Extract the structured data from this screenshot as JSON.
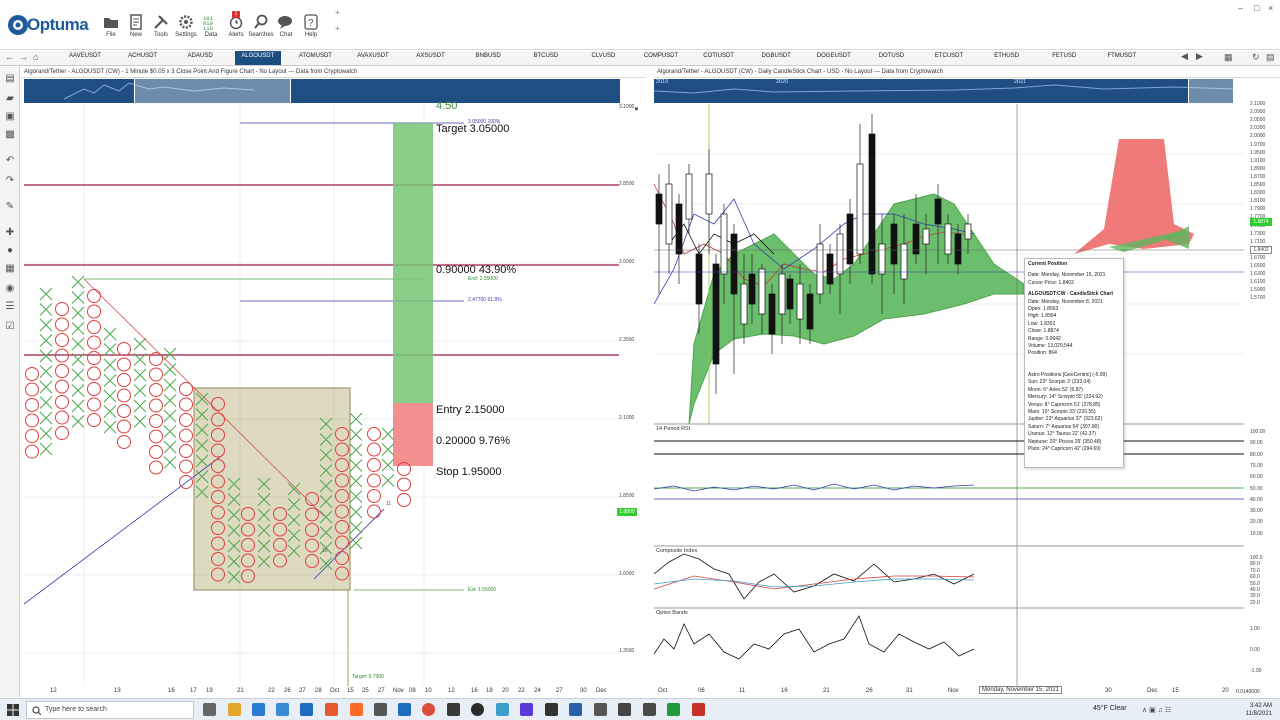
{
  "app": {
    "brand": "Optuma"
  },
  "toolbar": [
    {
      "label": "File",
      "icon": "folder-icon"
    },
    {
      "label": "New",
      "icon": "new-page-icon"
    },
    {
      "label": "Tools",
      "icon": "tools-icon"
    },
    {
      "label": "Settings",
      "icon": "gear-icon"
    },
    {
      "label": "Data",
      "icon": "data-icon"
    },
    {
      "label": "Alerts",
      "icon": "alarm-clock-icon",
      "badge": "1"
    },
    {
      "label": "Searches",
      "icon": "search-icon"
    },
    {
      "label": "Chat",
      "icon": "chat-icon"
    },
    {
      "label": "Help",
      "icon": "help-icon"
    }
  ],
  "symbols": [
    "AAVEUSDT",
    "ACHUSDT",
    "ADAUSD",
    "ALGOUSDT",
    "ATOMUSDT",
    "AVAXUSDT",
    "AXSUSDT",
    "BNBUSD",
    "BTCUSD",
    "CLVUSD",
    "COMPUSDT",
    "COTIUSDT",
    "DGBUSDT",
    "DOGEUSDT",
    "DOTUSD",
    "ETCUSDT",
    "ETHUSD",
    "FETUSD",
    "FTMUSDT"
  ],
  "active_symbol": "ALGOUSDT",
  "left_chart": {
    "title": "Algorand/Tether - ALGOUSDT (CW) - 1 Minute $0.05 x 3 Close Point And Figure Chart - No Layout --- Data from Cryptowatch",
    "y_ticks": [
      "3.1000",
      "2.8500",
      "2.6000",
      "2.3500",
      "2.1000",
      "1.8500",
      "1.6000",
      "1.3500"
    ],
    "price_badge": "1.8800",
    "x_ticks": [
      "12",
      "13",
      "16",
      "17",
      "19",
      "21",
      "22",
      "26",
      "27",
      "28",
      "Oct",
      "15",
      "25",
      "27",
      "Nov",
      "08",
      "10",
      "12",
      "16",
      "18",
      "20",
      "22",
      "24",
      "27",
      "30",
      "Dec"
    ],
    "top_value": "4.50",
    "target": "Target  3.05000",
    "ratio_up": "0.90000  43.90%",
    "entry": "Entry  2.15000",
    "ratio_down": "0.20000  9.76%",
    "stop": "Stop  1.95000",
    "small_target": "3.05000   100%",
    "small_end": "End: 2.55000",
    "small_fib": "2.47700   61.8%",
    "small_ext": "Ext: 1.55000",
    "small_target2": "Target: 0.7000",
    "count_labels": [
      "10",
      "11"
    ]
  },
  "right_chart": {
    "title": "Algorand/Tether - ALGOUSDT (CW) - Daily CandleStick Chart - USD - No Layout --- Data from Cryptowatch",
    "ov_years": [
      "2019",
      "2020",
      "2021"
    ],
    "y_ticks": [
      "2.1000",
      "2.0900",
      "2.0500",
      "2.0300",
      "2.0000",
      "1.9700",
      "1.9500",
      "1.9100",
      "1.8900",
      "1.8700",
      "1.8500",
      "1.8300",
      "1.8100",
      "1.7900",
      "1.7700",
      "1.7500",
      "1.7300",
      "1.7100",
      "1.6900",
      "1.6700",
      "1.6500",
      "1.6300",
      "1.6100",
      "1.5900",
      "1.5700"
    ],
    "price_badge": "1.8874",
    "cursor_badge": "1.8402",
    "x_ticks": [
      "Oct",
      "06",
      "11",
      "16",
      "21",
      "26",
      "31",
      "Nov",
      "30",
      "Dec",
      "15",
      "20"
    ],
    "cursor_date": "Monday, November 15, 2021",
    "rsi_label": "14 Period RSI",
    "rsi_ticks": [
      "100.00",
      "90.00",
      "80.00",
      "70.00",
      "60.00",
      "50.00",
      "40.00",
      "30.00",
      "20.00",
      "10.00"
    ],
    "ci_label": "Composite Index",
    "ci_ticks": [
      "100.0",
      "80.0",
      "70.0",
      "60.0",
      "50.0",
      "40.0",
      "30.0",
      "20.0"
    ],
    "ob_label": "Optex Bands",
    "ob_ticks": [
      "1.00",
      "0.00",
      "-1.00"
    ],
    "bottom_right_val": "0.0140000"
  },
  "info": {
    "header": "Current Position",
    "date": "Date: Monday, November 15, 2021",
    "cursor": "Cursor Price: 1.8402",
    "series": "ALGOUSDT:CW - CandleStick Chart",
    "rows": [
      "Date: Monday, November 8, 2021",
      "Open: 1.8663",
      "High: 1.8994",
      "Low: 1.8352",
      "Close: 1.8874",
      "Range: 0.0642",
      "Volume: 13,029,544",
      "Position: 864"
    ],
    "astro_header": "Astro Positions [GeoCentric] (-5:00)",
    "astro": [
      "Sun: 23° Scorpio 3' (233.04)",
      "Moon: 6° Aries 52' (6.87)",
      "Mercury: 14° Scorpio 55' (224.92)",
      "Venus: 8° Capricorn 51' (278.85)",
      "Mars: 10° Scorpio 33' (220.55)",
      "Jupiter: 23° Aquarius 37' (323.62)",
      "Saturn: 7° Aquarius 54' (307.90)",
      "Uranus: 12° Taurus 22' (42.37)",
      "Neptune: 20° Pisces 29' (350.48)",
      "Pluto: 24° Capricorn 42' (294.69)"
    ]
  },
  "taskbar": {
    "search_placeholder": "Type here to search",
    "weather": "45°F  Clear",
    "time": "3:42 AM",
    "date": "11/8/2021"
  },
  "colors": {
    "accent": "#1f4f82",
    "up_fill": "#5cb85c",
    "down_fill": "#f06b6b",
    "grid": "#ececec"
  }
}
